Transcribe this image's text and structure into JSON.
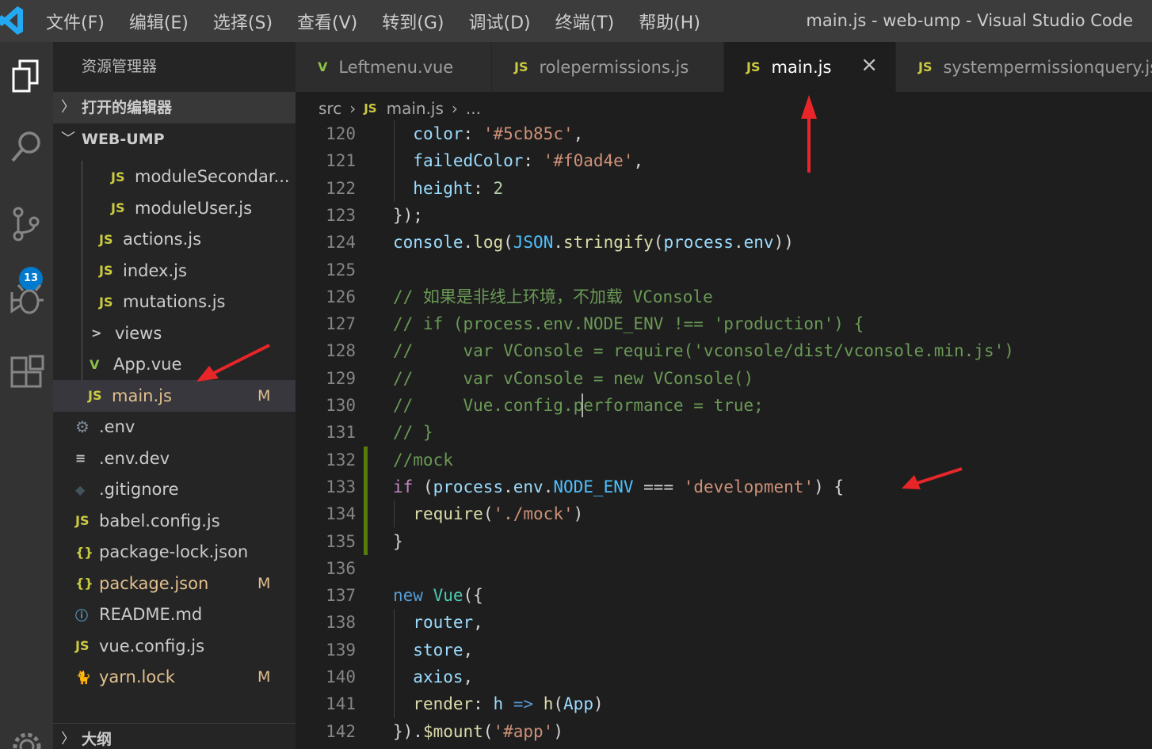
{
  "titlebar": {
    "menu": [
      "文件(F)",
      "编辑(E)",
      "选择(S)",
      "查看(V)",
      "转到(G)",
      "调试(D)",
      "终端(T)",
      "帮助(H)"
    ],
    "window_title": "main.js - web-ump - Visual Studio Code"
  },
  "activitybar": {
    "items": [
      "explorer-icon",
      "search-icon",
      "source-control-icon",
      "debug-icon",
      "extensions-icon",
      "settings-gear-icon"
    ],
    "scm_badge": "13"
  },
  "sidebar": {
    "title": "资源管理器",
    "open_editors": "打开的编辑器",
    "project": "WEB-UMP",
    "outline": "大纲",
    "tree": [
      {
        "icon": "JS",
        "label": "moduleSecondar...",
        "status": ""
      },
      {
        "icon": "JS",
        "label": "moduleUser.js",
        "status": ""
      },
      {
        "icon": "JS",
        "label": "actions.js",
        "status": ""
      },
      {
        "icon": "JS",
        "label": "index.js",
        "status": ""
      },
      {
        "icon": "JS",
        "label": "mutations.js",
        "status": ""
      },
      {
        "icon": ">",
        "label": "views",
        "status": ""
      },
      {
        "icon": "V",
        "label": "App.vue",
        "status": ""
      },
      {
        "icon": "JS",
        "label": "main.js",
        "status": "M"
      },
      {
        "icon": "⚙",
        "label": ".env",
        "status": ""
      },
      {
        "icon": "≡",
        "label": ".env.dev",
        "status": ""
      },
      {
        "icon": "◆",
        "label": ".gitignore",
        "status": ""
      },
      {
        "icon": "JS",
        "label": "babel.config.js",
        "status": ""
      },
      {
        "icon": "{}",
        "label": "package-lock.json",
        "status": ""
      },
      {
        "icon": "{}",
        "label": "package.json",
        "status": "M"
      },
      {
        "icon": "ⓘ",
        "label": "README.md",
        "status": ""
      },
      {
        "icon": "JS",
        "label": "vue.config.js",
        "status": ""
      },
      {
        "icon": "🐈",
        "label": "yarn.lock",
        "status": "M"
      }
    ]
  },
  "tabs": [
    {
      "icon": "V",
      "label": "Leftmenu.vue"
    },
    {
      "icon": "JS",
      "label": "rolepermissions.js"
    },
    {
      "icon": "JS",
      "label": "main.js",
      "active": true
    },
    {
      "icon": "JS",
      "label": "systempermissionquery.js"
    }
  ],
  "breadcrumb": {
    "folder": "src",
    "file_icon": "JS",
    "file": "main.js",
    "more": "..."
  },
  "editor": {
    "lines": [
      {
        "n": "120",
        "tokens": [
          [
            "plain",
            "  "
          ],
          [
            "prop",
            "color"
          ],
          [
            "plain",
            ": "
          ],
          [
            "str",
            "'#5cb85c'"
          ],
          [
            "plain",
            ","
          ]
        ]
      },
      {
        "n": "121",
        "tokens": [
          [
            "plain",
            "  "
          ],
          [
            "prop",
            "failedColor"
          ],
          [
            "plain",
            ": "
          ],
          [
            "str",
            "'#f0ad4e'"
          ],
          [
            "plain",
            ","
          ]
        ]
      },
      {
        "n": "122",
        "tokens": [
          [
            "plain",
            "  "
          ],
          [
            "prop",
            "height"
          ],
          [
            "plain",
            ": "
          ],
          [
            "num",
            "2"
          ]
        ]
      },
      {
        "n": "123",
        "tokens": [
          [
            "plain",
            "});"
          ]
        ]
      },
      {
        "n": "124",
        "tokens": [
          [
            "var",
            "console"
          ],
          [
            "plain",
            "."
          ],
          [
            "fn",
            "log"
          ],
          [
            "plain",
            "("
          ],
          [
            "const",
            "JSON"
          ],
          [
            "plain",
            "."
          ],
          [
            "fn",
            "stringify"
          ],
          [
            "plain",
            "("
          ],
          [
            "var",
            "process"
          ],
          [
            "plain",
            "."
          ],
          [
            "var",
            "env"
          ],
          [
            "plain",
            "))"
          ]
        ]
      },
      {
        "n": "125",
        "tokens": []
      },
      {
        "n": "126",
        "tokens": [
          [
            "com",
            "// 如果是非线上环境，不加载 VConsole"
          ]
        ]
      },
      {
        "n": "127",
        "tokens": [
          [
            "com",
            "// if (process.env.NODE_ENV !== 'production') {"
          ]
        ]
      },
      {
        "n": "128",
        "tokens": [
          [
            "com",
            "//     var VConsole = require('vconsole/dist/vconsole.min.js')"
          ]
        ]
      },
      {
        "n": "129",
        "tokens": [
          [
            "com",
            "//     var vConsole = new VConsole()"
          ]
        ]
      },
      {
        "n": "130",
        "tokens": [
          [
            "com",
            "//     Vue.config.performance = true;"
          ]
        ]
      },
      {
        "n": "131",
        "tokens": [
          [
            "com",
            "// }"
          ]
        ]
      },
      {
        "n": "132",
        "tokens": [
          [
            "com",
            "//mock"
          ]
        ]
      },
      {
        "n": "133",
        "tokens": [
          [
            "kw",
            "if"
          ],
          [
            "plain",
            " ("
          ],
          [
            "var",
            "process"
          ],
          [
            "plain",
            "."
          ],
          [
            "var",
            "env"
          ],
          [
            "plain",
            "."
          ],
          [
            "const",
            "NODE_ENV"
          ],
          [
            "plain",
            " === "
          ],
          [
            "str",
            "'development'"
          ],
          [
            "plain",
            ") {"
          ]
        ]
      },
      {
        "n": "134",
        "tokens": [
          [
            "plain",
            "  "
          ],
          [
            "fn",
            "require"
          ],
          [
            "plain",
            "("
          ],
          [
            "str",
            "'./mock'"
          ],
          [
            "plain",
            ")"
          ]
        ]
      },
      {
        "n": "135",
        "tokens": [
          [
            "plain",
            "}"
          ]
        ]
      },
      {
        "n": "136",
        "tokens": []
      },
      {
        "n": "137",
        "tokens": [
          [
            "new",
            "new"
          ],
          [
            "plain",
            " "
          ],
          [
            "cls",
            "Vue"
          ],
          [
            "plain",
            "({"
          ]
        ]
      },
      {
        "n": "138",
        "tokens": [
          [
            "plain",
            "  "
          ],
          [
            "var",
            "router"
          ],
          [
            "plain",
            ","
          ]
        ]
      },
      {
        "n": "139",
        "tokens": [
          [
            "plain",
            "  "
          ],
          [
            "var",
            "store"
          ],
          [
            "plain",
            ","
          ]
        ]
      },
      {
        "n": "140",
        "tokens": [
          [
            "plain",
            "  "
          ],
          [
            "var",
            "axios"
          ],
          [
            "plain",
            ","
          ]
        ]
      },
      {
        "n": "141",
        "tokens": [
          [
            "plain",
            "  "
          ],
          [
            "fn",
            "render"
          ],
          [
            "plain",
            ": "
          ],
          [
            "var",
            "h"
          ],
          [
            "plain",
            " "
          ],
          [
            "new",
            "=>"
          ],
          [
            "plain",
            " "
          ],
          [
            "fn",
            "h"
          ],
          [
            "plain",
            "("
          ],
          [
            "var",
            "App"
          ],
          [
            "plain",
            ")"
          ]
        ]
      },
      {
        "n": "142",
        "tokens": [
          [
            "plain",
            "})."
          ],
          [
            "fn",
            "$mount"
          ],
          [
            "plain",
            "("
          ],
          [
            "str",
            "'#app'"
          ],
          [
            "plain",
            ")"
          ]
        ]
      }
    ]
  },
  "colors": {
    "accent": "#007acc",
    "modified": "#e2c08d",
    "annotation_arrow": "#e8262a"
  }
}
